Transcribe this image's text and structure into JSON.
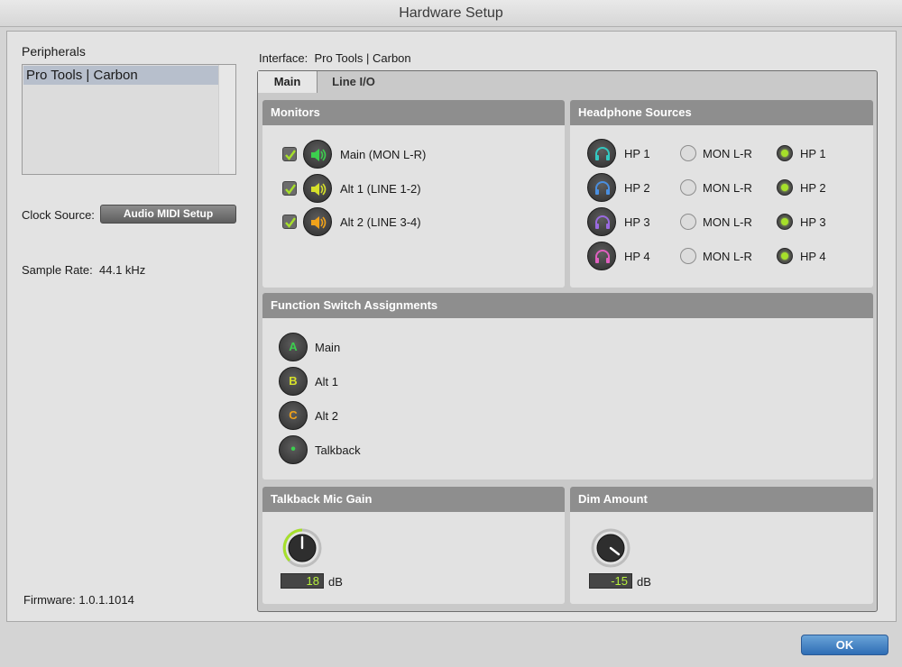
{
  "window": {
    "title": "Hardware Setup"
  },
  "peripherals": {
    "label": "Peripherals",
    "items": [
      "Pro Tools | Carbon"
    ]
  },
  "clock": {
    "label": "Clock Source:",
    "button": "Audio MIDI Setup"
  },
  "sample_rate": {
    "label": "Sample Rate:",
    "value": "44.1 kHz"
  },
  "firmware": {
    "label": "Firmware:",
    "value": "1.0.1.1014"
  },
  "interface": {
    "label": "Interface:",
    "value": "Pro Tools | Carbon"
  },
  "tabs": [
    {
      "label": "Main",
      "active": true
    },
    {
      "label": "Line I/O",
      "active": false
    }
  ],
  "monitors": {
    "title": "Monitors",
    "items": [
      {
        "label": "Main (MON L-R)",
        "checked": true,
        "color": "#3ccf4e"
      },
      {
        "label": "Alt 1 (LINE 1-2)",
        "checked": true,
        "color": "#d6e02a"
      },
      {
        "label": "Alt 2 (LINE 3-4)",
        "checked": true,
        "color": "#f0a21a"
      }
    ]
  },
  "headphones": {
    "title": "Headphone Sources",
    "rows": [
      {
        "name": "HP 1",
        "color": "#33c7c0",
        "mon": "MON L-R",
        "hp": "HP 1",
        "selected": "hp"
      },
      {
        "name": "HP 2",
        "color": "#4a8fe0",
        "mon": "MON L-R",
        "hp": "HP 2",
        "selected": "hp"
      },
      {
        "name": "HP 3",
        "color": "#9a6ae0",
        "mon": "MON L-R",
        "hp": "HP 3",
        "selected": "hp"
      },
      {
        "name": "HP 4",
        "color": "#e060c0",
        "mon": "MON L-R",
        "hp": "HP 4",
        "selected": "hp"
      }
    ]
  },
  "function_switch": {
    "title": "Function Switch Assignments",
    "items": [
      {
        "key": "A",
        "label": "Main",
        "color": "#3ccf4e"
      },
      {
        "key": "B",
        "label": "Alt 1",
        "color": "#d6e02a"
      },
      {
        "key": "C",
        "label": "Alt 2",
        "color": "#f0a21a"
      },
      {
        "key": "•",
        "label": "Talkback",
        "color": "#3ccf4e"
      }
    ]
  },
  "talkback": {
    "title": "Talkback Mic Gain",
    "value": "18",
    "unit": "dB",
    "level": 0.3
  },
  "dim": {
    "title": "Dim Amount",
    "value": "-15",
    "unit": "dB",
    "level": 0.0
  },
  "buttons": {
    "ok": "OK"
  },
  "colors": {
    "accent_green": "#a6e02a",
    "panel_header": "#8e8e8e",
    "ok_blue": "#2e6db5"
  }
}
